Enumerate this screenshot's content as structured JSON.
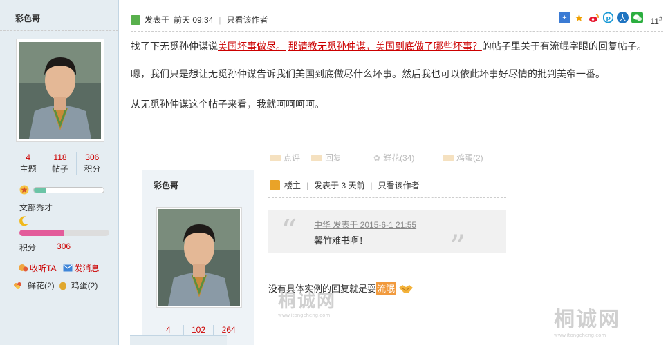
{
  "user": {
    "name": "彩色哥",
    "stats": [
      {
        "value": "4",
        "label": "主题"
      },
      {
        "value": "118",
        "label": "帖子"
      },
      {
        "value": "306",
        "label": "积分"
      }
    ],
    "rank_name": "文部秀才",
    "credit_label": "积分",
    "credit_value": "306",
    "follow_label": "收听TA",
    "message_label": "发消息",
    "flowers": "鲜花(2)",
    "eggs": "鸡蛋(2)"
  },
  "post": {
    "posted_label": "发表于",
    "posted_time": "前天 09:34",
    "view_author": "只看该作者",
    "floor_num": "11",
    "floor_sup": "#",
    "para1_pre": "找了下无觅孙仲谋说",
    "para1_link1": "美国坏事做尽。",
    "para1_link2": "那请教无觅孙仲谋，美国到底做了哪些坏事？",
    "para1_post": "的帖子里关于有流氓字眼的回复帖子。",
    "para2": "嗯，我们只是想让无觅孙仲谋告诉我们美国到底做尽什么坏事。然后我也可以依此坏事好尽情的批判美帝一番。",
    "para3": "从无觅孙仲谋这个帖子来看，我就呵呵呵呵。"
  },
  "embed": {
    "faint_items": [
      "点评",
      "回复",
      "鲜花(34)",
      "鸡蛋(2)"
    ],
    "user_name": "彩色哥",
    "stats": [
      "4",
      "102",
      "264"
    ],
    "op_label": "楼主",
    "posted": "发表于 3 天前",
    "view_author": "只看该作者",
    "quote_head": "中华 发表于 2015-6-1 21:55",
    "quote_text": "馨竹难书啊！",
    "reply_pre": "没有具体实例的回复就是耍",
    "reply_hl": "流氓"
  },
  "watermark": {
    "text": "桐诚网",
    "sub": "www.itongcheng.com"
  },
  "colors": {
    "sidebar_bg": "#e5edf2",
    "link_red": "#cc0000",
    "accent_orange": "#f19a3d"
  }
}
